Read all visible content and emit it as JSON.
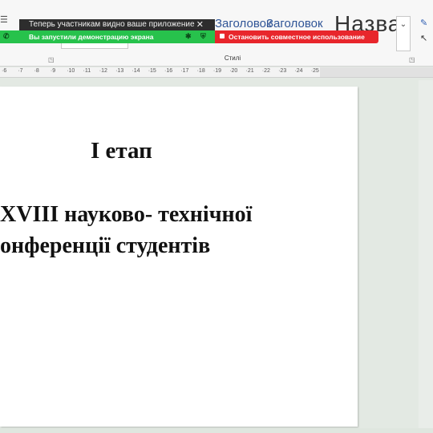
{
  "ribbon": {
    "styles_group_label": "Стилі",
    "style_samples": [
      "Заголовок",
      "Заголовок",
      "Назва"
    ]
  },
  "notification": {
    "text": "Теперь участникам видно ваше приложение",
    "close_glyph": "✕"
  },
  "screen_share": {
    "status": "Вы запустили демонстрацию экрана",
    "stop_button": "Остановить совместное использование"
  },
  "ruler": {
    "labels": [
      "6",
      "7",
      "8",
      "9",
      "10",
      "11",
      "12",
      "13",
      "14",
      "15",
      "16",
      "17",
      "18",
      "19",
      "20",
      "21",
      "22",
      "23",
      "24",
      "25"
    ]
  },
  "document": {
    "line_etap": "І етап",
    "line_1": "XVIII науково- технічної",
    "line_2": "онференції студентів"
  },
  "colors": {
    "share_green": "#27c24c",
    "stop_red": "#e8262c",
    "heading_blue": "#2f5597"
  },
  "icons": {
    "share_left": "phone-icon",
    "share_pin": "pin-icon",
    "share_shield": "shield-icon"
  }
}
